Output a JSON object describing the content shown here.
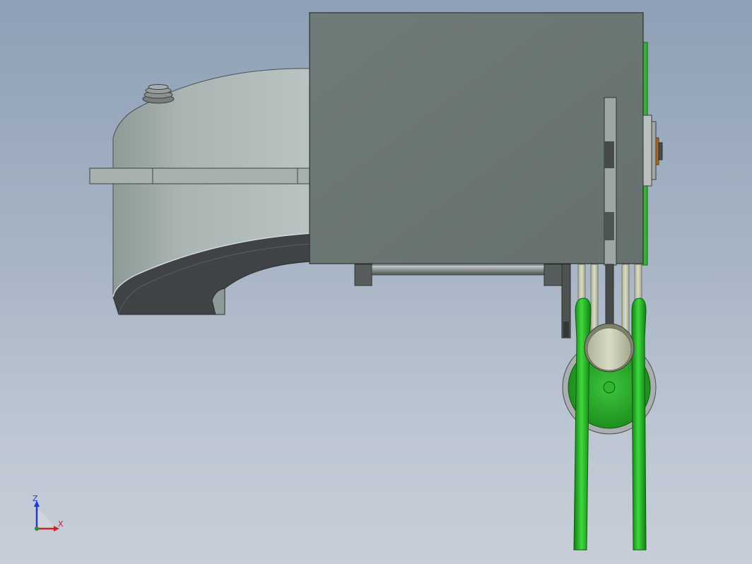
{
  "viewport": {
    "background_top": "#8ea0b6",
    "background_bottom": "#c7ced9"
  },
  "model": {
    "colors": {
      "housing": "#6b7775",
      "curved_body": "#a9b4b2",
      "curved_body_underside": "#404346",
      "arm_green": "#2fc42f",
      "arm_green_dark": "#137e13",
      "pulley_green": "#35b535",
      "roller": "#c8cbb2",
      "copper_accent": "#a46a2a"
    }
  },
  "triad": {
    "x_label": "X",
    "z_label": "Z",
    "x_color": "#c8262a",
    "z_color": "#1f3bd1"
  }
}
